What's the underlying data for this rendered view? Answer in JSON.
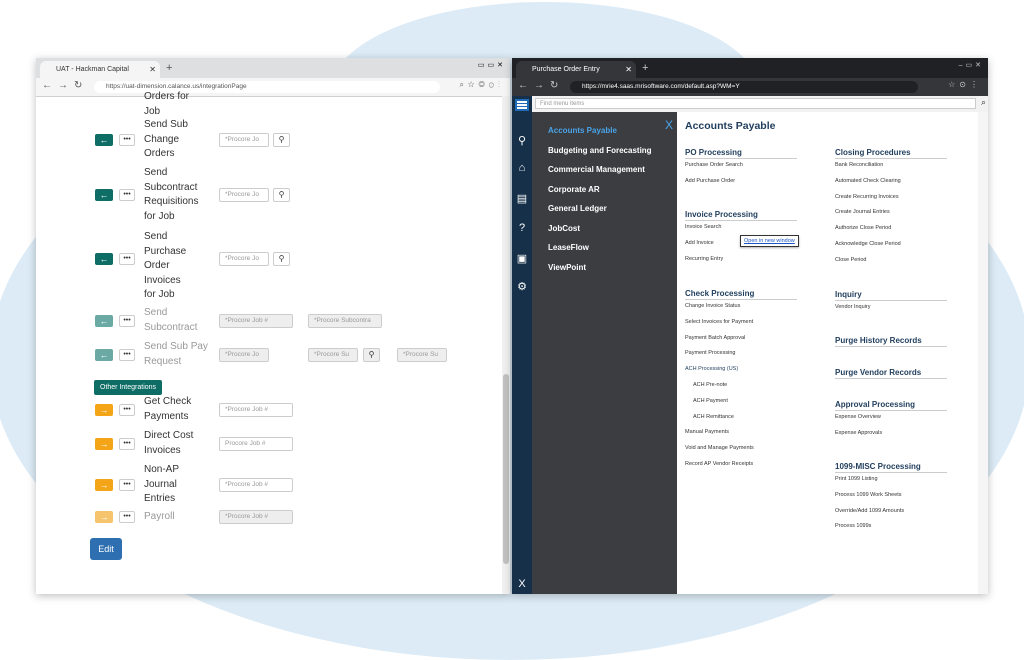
{
  "left_window": {
    "tab_title": "UAT - Hackman Capital",
    "url": "https://uat-dimension.calance.us/integrationPage",
    "rows": [
      {
        "label": "Orders for Job",
        "arrow": "",
        "inputs": [],
        "state": "partial"
      },
      {
        "label": "Send Sub Change Orders",
        "arrow": "←",
        "inputs": [
          "*Procore Jo"
        ],
        "search": true,
        "state": "active"
      },
      {
        "label": "Send Subcontract Requisitions for Job",
        "arrow": "←",
        "inputs": [
          "*Procore Jo"
        ],
        "search": true,
        "state": "active"
      },
      {
        "label": "Send Purchase Order Invoices for Job",
        "arrow": "←",
        "inputs": [
          "*Procore Jo"
        ],
        "search": true,
        "state": "active"
      },
      {
        "label": "Send Subcontract",
        "arrow": "←",
        "inputs": [
          "*Procore Job #",
          "*Procore Subcontra"
        ],
        "state": "disabled"
      },
      {
        "label": "Send Sub Pay Request",
        "arrow": "←",
        "inputs": [
          "*Procore Jo",
          "*Procore Su",
          "*Procore Su"
        ],
        "search": true,
        "state": "disabled"
      },
      {
        "label": "Get Check Payments",
        "arrow": "→",
        "inputs": [
          "*Procore Job #"
        ],
        "state": "orange"
      },
      {
        "label": "Direct Cost Invoices",
        "arrow": "→",
        "inputs": [
          "Procore Job #"
        ],
        "state": "orange"
      },
      {
        "label": "Non-AP Journal Entries",
        "arrow": "→",
        "inputs": [
          "*Procore Job #"
        ],
        "state": "orange"
      },
      {
        "label": "Payroll",
        "arrow": "→",
        "inputs": [
          "*Procore Job #"
        ],
        "state": "orange-disabled"
      }
    ],
    "other_integrations_label": "Other Integrations",
    "edit_label": "Edit"
  },
  "right_window": {
    "tab_title": "Purchase Order Entry",
    "url": "https://mrie4.saas.mrisoftware.com/default.asp?WM=Y",
    "find_placeholder": "Find menu items",
    "menu_items": [
      "Accounts Payable",
      "Budgeting and Forecasting",
      "Commercial Management",
      "Corporate AR",
      "General Ledger",
      "JobCost",
      "LeaseFlow",
      "ViewPoint"
    ],
    "active_menu": "Accounts Payable",
    "close_label": "X",
    "main_title": "Accounts Payable",
    "tooltip": "Open in new window",
    "col1": [
      {
        "heading": "PO Processing",
        "links": [
          "Purchase Order Search",
          "Add Purchase Order"
        ]
      },
      {
        "heading": "Invoice Processing",
        "links": [
          "Invoice Search",
          "Add Invoice",
          "Recurring Entry"
        ]
      },
      {
        "heading": "Check Processing",
        "links": [
          "Change Invoice Status",
          "Select Invoices for Payment",
          "Payment Batch Approval",
          "Payment Processing",
          "ACH Processing (US)",
          "ACH Pre-note",
          "ACH Payment",
          "ACH Remittance",
          "Manual Payments",
          "Void and Manage Payments",
          "Record AP Vendor Receipts"
        ]
      }
    ],
    "col2": [
      {
        "heading": "Closing Procedures",
        "links": [
          "Bank Reconciliation",
          "Automated Check Clearing",
          "Create Recurring Invoices",
          "Create Journal Entries",
          "Authorize Close Period",
          "Acknowledge Close Period",
          "Close Period"
        ]
      },
      {
        "heading": "Inquiry",
        "links": [
          "Vendor Inquiry"
        ]
      },
      {
        "heading": "Purge History Records",
        "links": []
      },
      {
        "heading": "Purge Vendor Records",
        "links": []
      },
      {
        "heading": "Approval Processing",
        "links": [
          "Expense Overview",
          "Expense Approvals"
        ]
      },
      {
        "heading": "1099-MISC Processing",
        "links": [
          "Print 1099 Listing",
          "Process 1099 Work Sheets",
          "Override/Add 1099 Amounts",
          "Process 1099s"
        ]
      }
    ]
  },
  "colors": {
    "teal": "#0e6e66",
    "teal_disabled": "#6aa9a4",
    "orange": "#f3a417",
    "orange_disabled": "#f7c46e",
    "navy": "#16304a",
    "accent_blue": "#4aa3e8"
  }
}
